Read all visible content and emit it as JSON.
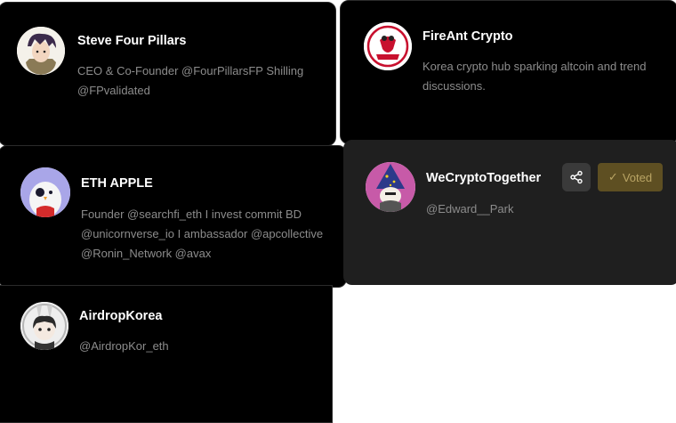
{
  "cards": [
    {
      "name": "Steve Four Pillars",
      "description": "CEO & Co-Founder @FourPillarsFP Shilling @FPvalidated",
      "avatar_icon": "anime-character-avatar"
    },
    {
      "name": "FireAnt Crypto",
      "description": "Korea crypto hub sparking altcoin and trend discussions.",
      "avatar_icon": "fire-ant-logo-avatar"
    },
    {
      "name": "ETH APPLE",
      "description": "Founder @searchfi_eth I invest commit BD @unicornverse_io I ambassador @apcollective @Ronin_Network @avax",
      "avatar_icon": "penguin-avatar"
    },
    {
      "name": "WeCryptoTogether",
      "description": "@Edward__Park",
      "avatar_icon": "wizard-avatar",
      "actions": {
        "share_icon": "share-icon",
        "voted_label": "Voted",
        "voted_icon": "check-icon"
      }
    },
    {
      "name": "AirdropKorea",
      "description": "@AirdropKor_eth",
      "avatar_icon": "bunny-girl-avatar"
    }
  ],
  "colors": {
    "card_bg": "#000000",
    "highlight_bg": "#1f1f1f",
    "voted_bg": "#5e4f22",
    "voted_text": "#b9a464"
  }
}
